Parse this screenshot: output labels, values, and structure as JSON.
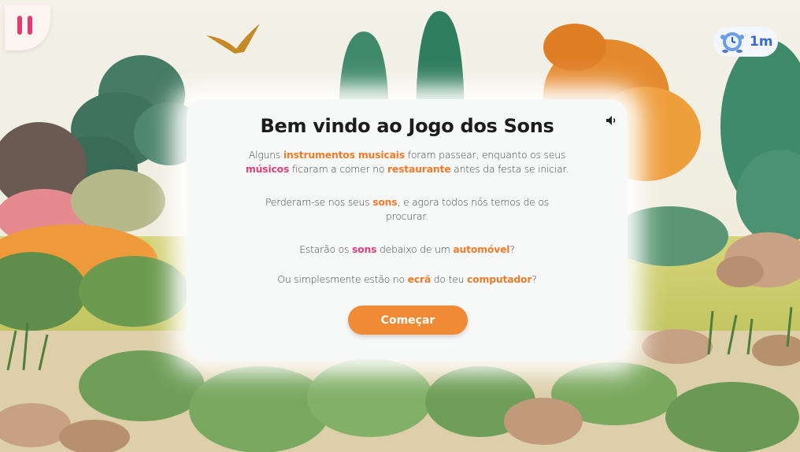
{
  "colors": {
    "accent": "#f08a35",
    "pause": "#e53974",
    "title": "#1c1c1c",
    "body_text": "#444444",
    "highlight_orange": "#f37b2b",
    "highlight_pink": "#e0417a",
    "timer_text": "#3a6ad6"
  },
  "hud": {
    "pause_icon": "pause-icon",
    "timer_icon": "clock-mascot-icon",
    "timer_value": "1m"
  },
  "modal": {
    "title": "Bem vindo ao Jogo dos Sons",
    "sound_icon": "speaker-icon",
    "p1": {
      "t1": "Alguns ",
      "h1": "instrumentos musicais",
      "t2": " foram passear, enquanto os seus",
      "h2": "músicos",
      "t3": " ficaram a comer no ",
      "h3": "restaurante",
      "t4": " antes da festa se iniciar."
    },
    "p2": {
      "t1": "Perderam-se nos seus ",
      "h1": "sons",
      "t2": ", e agora todos nós temos de os",
      "t3": "procurar."
    },
    "p3": {
      "t1": "Estarão os ",
      "h1": "sons",
      "t2": " debaixo de um ",
      "h2": "automóvel",
      "t3": "?"
    },
    "p4": {
      "t1": "Ou simplesmente estão no ",
      "h1": "ecrã",
      "t2": " do teu ",
      "h2": "computador",
      "t3": "?"
    },
    "start_label": "Começar"
  }
}
